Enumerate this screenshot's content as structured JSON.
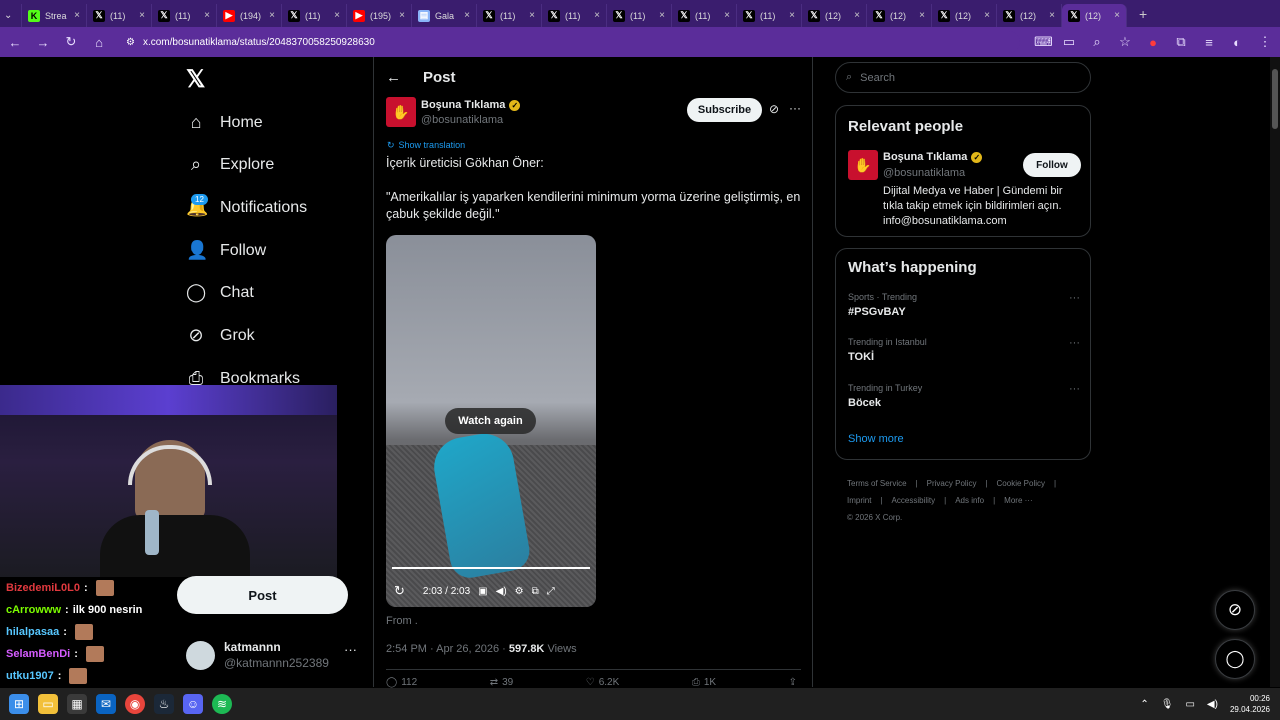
{
  "browser": {
    "tabs": [
      {
        "icon": "kick-icon",
        "label": "Strea",
        "color": "#53fc18",
        "glyph": "K"
      },
      {
        "icon": "x-icon",
        "label": "(11)",
        "color": "#000000",
        "glyph": "𝕏"
      },
      {
        "icon": "x-icon",
        "label": "(11)",
        "color": "#000000",
        "glyph": "𝕏"
      },
      {
        "icon": "youtube-icon",
        "label": "(194)",
        "color": "#ff0000",
        "glyph": "▶"
      },
      {
        "icon": "x-icon",
        "label": "(11)",
        "color": "#000000",
        "glyph": "𝕏"
      },
      {
        "icon": "youtube-icon",
        "label": "(195)",
        "color": "#ff0000",
        "glyph": "▶"
      },
      {
        "icon": "page-icon",
        "label": "Gala",
        "color": "#8ab4f8",
        "glyph": "▤"
      },
      {
        "icon": "x-icon",
        "label": "(11)",
        "color": "#000000",
        "glyph": "𝕏"
      },
      {
        "icon": "x-icon",
        "label": "(11)",
        "color": "#000000",
        "glyph": "𝕏"
      },
      {
        "icon": "x-icon",
        "label": "(11)",
        "color": "#000000",
        "glyph": "𝕏"
      },
      {
        "icon": "x-icon",
        "label": "(11)",
        "color": "#000000",
        "glyph": "𝕏"
      },
      {
        "icon": "x-icon",
        "label": "(11)",
        "color": "#000000",
        "glyph": "𝕏"
      },
      {
        "icon": "x-icon",
        "label": "(12)",
        "color": "#000000",
        "glyph": "𝕏"
      },
      {
        "icon": "x-icon",
        "label": "(12)",
        "color": "#000000",
        "glyph": "𝕏"
      },
      {
        "icon": "x-icon",
        "label": "(12)",
        "color": "#000000",
        "glyph": "𝕏"
      },
      {
        "icon": "x-icon",
        "label": "(12)",
        "color": "#000000",
        "glyph": "𝕏"
      },
      {
        "icon": "x-icon",
        "label": "(12)",
        "color": "#000000",
        "glyph": "𝕏",
        "active": true
      }
    ],
    "url": "x.com/bosunatiklama/status/2048370058250928630",
    "accent": "#5b2d9a"
  },
  "sidebar": {
    "logo": "𝕏",
    "notif_badge": "12",
    "items": [
      {
        "label": "Home",
        "icon": "home-icon",
        "glyph": "⌂"
      },
      {
        "label": "Explore",
        "icon": "search-icon",
        "glyph": "⌕"
      },
      {
        "label": "Notifications",
        "icon": "bell-icon",
        "glyph": "🔔"
      },
      {
        "label": "Follow",
        "icon": "add-person-icon",
        "glyph": "👤"
      },
      {
        "label": "Chat",
        "icon": "chat-icon",
        "glyph": "◯"
      },
      {
        "label": "Grok",
        "icon": "grok-icon",
        "glyph": "⊘"
      },
      {
        "label": "Bookmarks",
        "icon": "bookmark-icon",
        "glyph": "⎙"
      }
    ],
    "post_button": "Post",
    "account": {
      "name": "katmannn",
      "handle": "@katmannn252389"
    }
  },
  "stream_chat": [
    {
      "user": "BizedemiL0L0",
      "msg": "",
      "color": "#e0393e"
    },
    {
      "user": "cArrowww",
      "msg": "ilk 900 nesrin",
      "color": "#7cfc00"
    },
    {
      "user": "hilalpasaa",
      "msg": "",
      "color": "#57c7ff"
    },
    {
      "user": "SelamBenDi",
      "msg": "",
      "color": "#d55cff"
    },
    {
      "user": "utku1907",
      "msg": "",
      "color": "#57c7ff"
    }
  ],
  "post": {
    "header": "Post",
    "author": {
      "name": "Boşuna Tıklama",
      "handle": "@bosunatiklama"
    },
    "subscribe": "Subscribe",
    "translate": "Show translation",
    "text": "İçerik üreticisi Gökhan Öner:\n\n\"Amerikalılar iş yaparken kendilerini minimum yorma üzerine geliştirmiş, en çabuk şekilde değil.\"",
    "video": {
      "watch_again": "Watch again",
      "time": "2:03 / 2:03",
      "progress": 1.0
    },
    "from": "From .",
    "meta": {
      "time": "2:54 PM · Apr 26, 2026 · ",
      "views_count": "597.8K",
      "views_label": " Views"
    },
    "actions": [
      {
        "icon": "reply-icon",
        "glyph": "◯",
        "count": "112"
      },
      {
        "icon": "repost-icon",
        "glyph": "⇄",
        "count": "39"
      },
      {
        "icon": "like-icon",
        "glyph": "♡",
        "count": "6.2K"
      },
      {
        "icon": "bookmark-icon",
        "glyph": "⎙",
        "count": "1K"
      },
      {
        "icon": "share-icon",
        "glyph": "⇪",
        "count": ""
      }
    ]
  },
  "right": {
    "search_placeholder": "Search",
    "relevant": {
      "title": "Relevant people",
      "name": "Boşuna Tıklama",
      "handle": "@bosunatiklama",
      "bio": "Dijital Medya ve Haber | Gündemi bir tıkla takip etmek için bildirimleri açın. info@bosunatiklama.com",
      "follow": "Follow"
    },
    "happening": {
      "title": "What’s happening",
      "trends": [
        {
          "context": "Sports · Trending",
          "name": "#PSGvBAY"
        },
        {
          "context": "Trending in Istanbul",
          "name": "TOKİ"
        },
        {
          "context": "Trending in Turkey",
          "name": "Böcek"
        }
      ],
      "show_more": "Show more"
    },
    "footer": [
      "Terms of Service",
      "|",
      "Privacy Policy",
      "|",
      "Cookie Policy",
      "|",
      "Imprint",
      "|",
      "Accessibility",
      "|",
      "Ads info",
      "|",
      "More ···",
      "© 2026 X Corp."
    ]
  },
  "taskbar": {
    "time": "00:26",
    "date": "29.04.2026"
  }
}
